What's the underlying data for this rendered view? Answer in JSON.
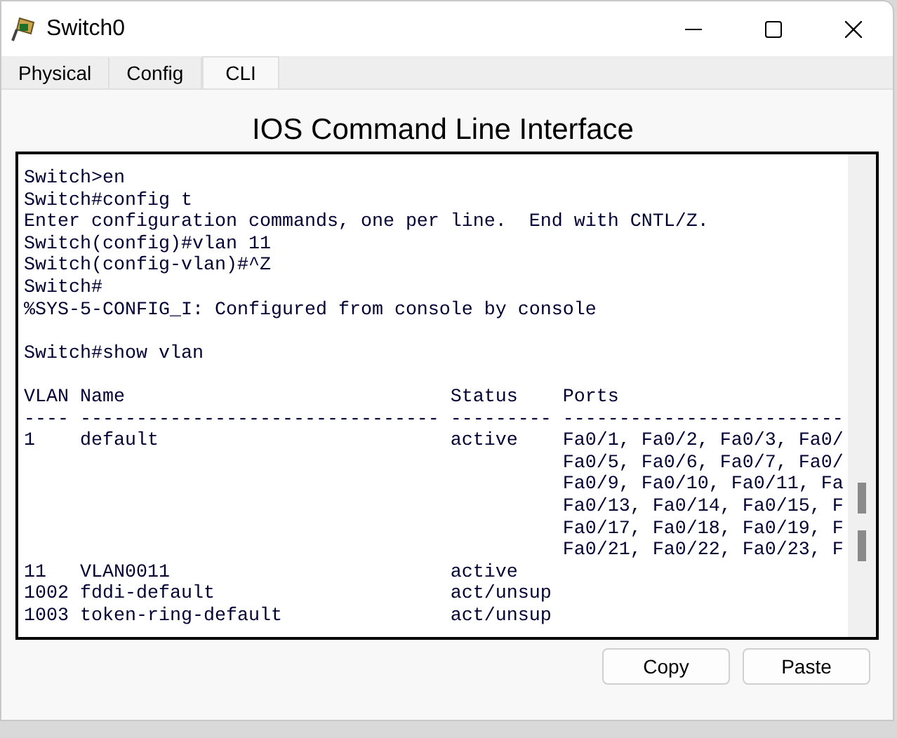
{
  "window": {
    "title": "Switch0"
  },
  "tabs": [
    {
      "label": "Physical",
      "selected": false
    },
    {
      "label": "Config",
      "selected": false
    },
    {
      "label": "CLI",
      "selected": true
    }
  ],
  "heading": "IOS Command Line Interface",
  "terminal": {
    "blocks": [
      [
        "Switch>en",
        "Switch#config t",
        "Enter configuration commands, one per line.  End with CNTL/Z.",
        "Switch(config)#vlan 11",
        "Switch(config-vlan)#^Z",
        "Switch#",
        "%SYS-5-CONFIG_I: Configured from console by console"
      ],
      [
        "Switch#show vlan"
      ],
      [
        "VLAN Name                             Status    Ports",
        "---- -------------------------------- --------- -------------------------",
        "1    default                          active    Fa0/1, Fa0/2, Fa0/3, Fa0/",
        "                                                Fa0/5, Fa0/6, Fa0/7, Fa0/",
        "                                                Fa0/9, Fa0/10, Fa0/11, Fa",
        "                                                Fa0/13, Fa0/14, Fa0/15, F",
        "                                                Fa0/17, Fa0/18, Fa0/19, F",
        "                                                Fa0/21, Fa0/22, Fa0/23, F",
        "11   VLAN0011                         active",
        "1002 fddi-default                     act/unsup",
        "1003 token-ring-default               act/unsup"
      ]
    ]
  },
  "buttons": [
    "Copy",
    "Paste"
  ]
}
